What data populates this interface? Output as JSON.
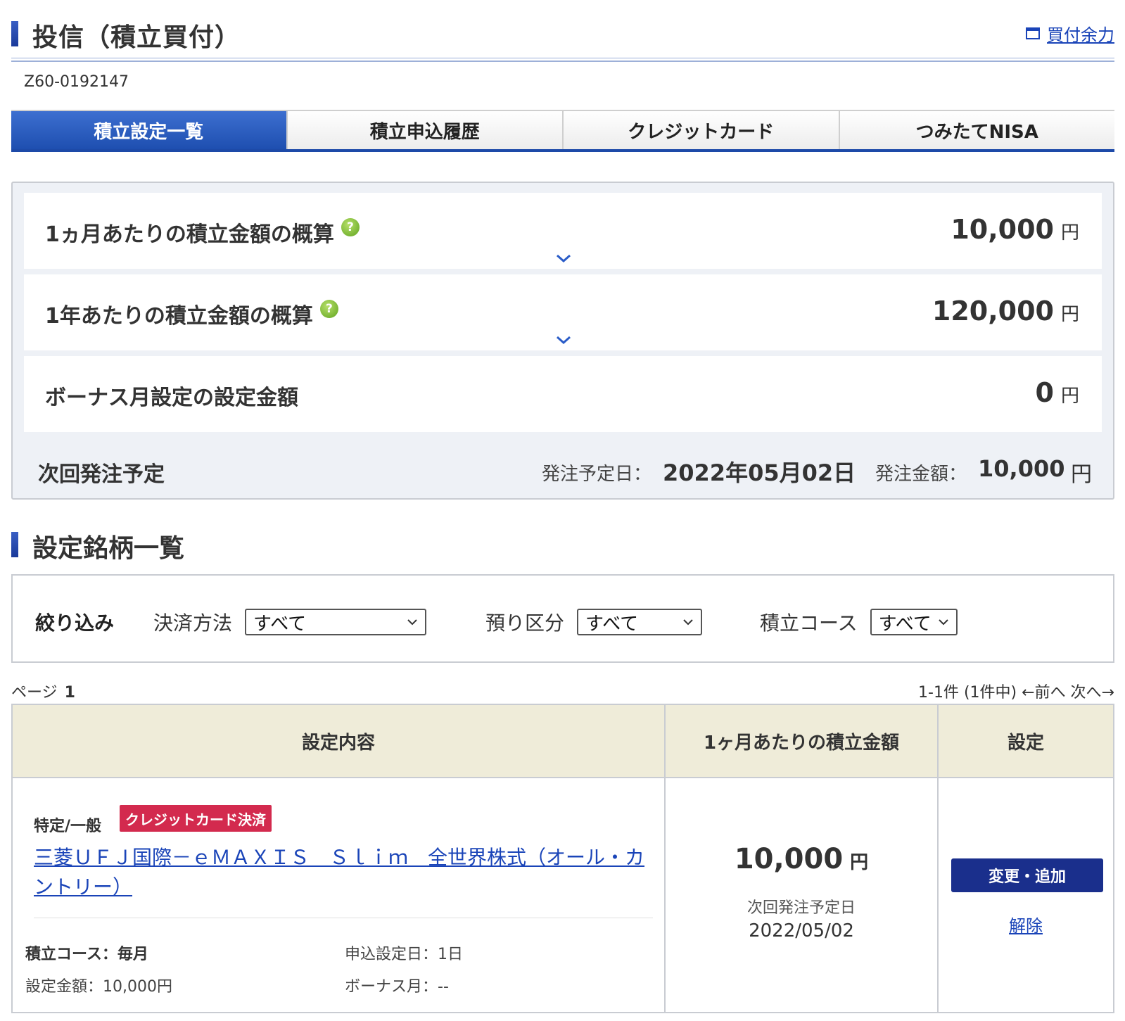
{
  "header": {
    "title": "投信（積立買付）",
    "buying_power_link": "買付余力",
    "account_id": "Z60-0192147"
  },
  "tabs": [
    {
      "label": "積立設定一覧",
      "active": true
    },
    {
      "label": "積立申込履歴",
      "active": false
    },
    {
      "label": "クレジットカード",
      "active": false
    },
    {
      "label": "つみたてNISA",
      "active": false
    }
  ],
  "summary": {
    "monthly": {
      "label": "1ヵ月あたりの積立金額の概算",
      "value": "10,000",
      "unit": "円"
    },
    "yearly": {
      "label": "1年あたりの積立金額の概算",
      "value": "120,000",
      "unit": "円"
    },
    "bonus": {
      "label": "ボーナス月設定の設定金額",
      "value": "0",
      "unit": "円"
    },
    "next_order": {
      "label": "次回発注予定",
      "date_label": "発注予定日：",
      "date": "2022年05月02日",
      "amount_label": "発注金額：",
      "amount": "10,000",
      "unit": "円"
    }
  },
  "section2": {
    "title": "設定銘柄一覧",
    "filter": {
      "label": "絞り込み",
      "payment_label": "決済方法",
      "payment_value": "すべて",
      "custody_label": "預り区分",
      "custody_value": "すべて",
      "course_label": "積立コース",
      "course_value": "すべて"
    },
    "pager": {
      "page_label": "ページ",
      "page_num": "1",
      "range": "1-1件 (1件中) ←前へ  次へ→"
    }
  },
  "table": {
    "headers": [
      "設定内容",
      "1ヶ月あたりの積立金額",
      "設定"
    ],
    "row": {
      "account_type": "特定/一般",
      "badge": "クレジットカード決済",
      "fund_name": "三菱ＵＦＪ国際－ｅＭＡＸＩＳ　Ｓｌｉｍ　全世界株式（オール・カントリー）",
      "course": "積立コース：毎月",
      "apply_day": "申込設定日：1日",
      "set_amount": "設定金額：10,000円",
      "bonus_month": "ボーナス月：--",
      "monthly_amount": "10,000",
      "monthly_unit": "円",
      "next_label": "次回発注予定日",
      "next_date": "2022/05/02",
      "change_button": "変更・追加",
      "cancel_link": "解除"
    }
  },
  "colors": {
    "accent_blue": "#1e4fb0",
    "link_blue": "#1a44b8",
    "badge_red": "#d32a4e",
    "button_navy": "#1a2f8c",
    "table_header_bg": "#efecd9",
    "help_icon_green": "#5fa31e"
  },
  "icons": [
    "window-icon",
    "help-icon",
    "chevron-down-icon",
    "select-caret-icon"
  ]
}
